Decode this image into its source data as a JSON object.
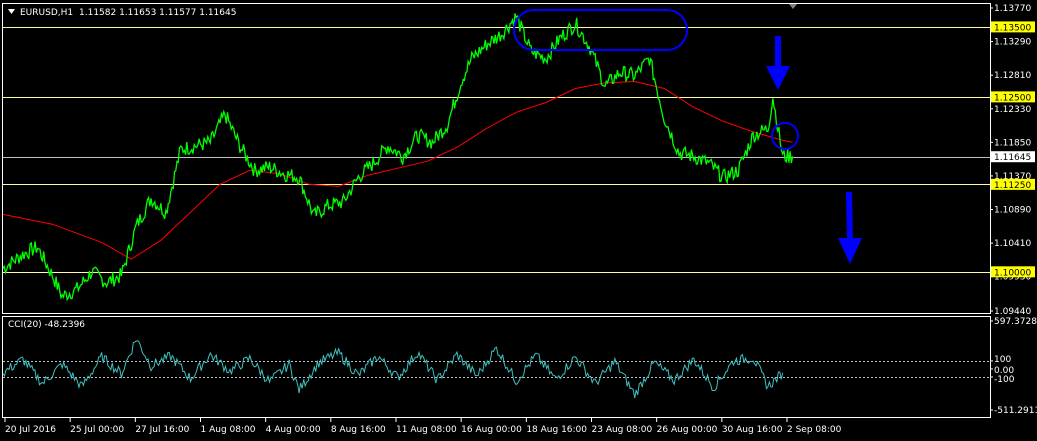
{
  "header": {
    "symbol": "EURUSD,H1",
    "ohlc": "1.11582 1.11653 1.11577 1.11645"
  },
  "indicator": {
    "label": "CCI(20) -48.2396",
    "axis_ticks": [
      "597.3728",
      "100",
      "0.00",
      "-100",
      "-511.2911"
    ]
  },
  "colors": {
    "background": "#000000",
    "price": "#00ff00",
    "moving_average": "#ff0000",
    "horizontal_level": "#ffff99",
    "current_price_line": "#c0c0c0",
    "cci": "#40c0c0",
    "annotation": "#0000ff",
    "label_highlight": "#ffff00",
    "axis": "#ffffff"
  },
  "icons": {
    "dropdown": "triangle-down-icon",
    "annotation_arrow": "down-arrow-icon",
    "annotation_ellipse": "ellipse-icon",
    "annotation_circle": "circle-icon"
  },
  "chart_data": [
    {
      "type": "line",
      "ylim": [
        1.0944,
        1.1377
      ],
      "y_ticks": [
        "1.13770",
        "1.13290",
        "1.12810",
        "1.12330",
        "1.11850",
        "1.11370",
        "1.10890",
        "1.10410",
        "1.09930",
        "1.09440"
      ],
      "x_ticks": [
        "20 Jul 2016",
        "25 Jul 00:00",
        "27 Jul 16:00",
        "1 Aug 08:00",
        "4 Aug 00:00",
        "8 Aug 16:00",
        "11 Aug 08:00",
        "16 Aug 00:00",
        "18 Aug 16:00",
        "23 Aug 08:00",
        "26 Aug 00:00",
        "30 Aug 16:00",
        "2 Sep 08:00"
      ],
      "levels": [
        {
          "label": "1.13500",
          "value": 1.135
        },
        {
          "label": "1.12500",
          "value": 1.125
        },
        {
          "label": "1.11250",
          "value": 1.1125
        },
        {
          "label": "1.10000",
          "value": 1.1
        }
      ],
      "current_price": {
        "label": "1.11645",
        "value": 1.11645
      },
      "series": [
        {
          "x": [
            0,
            0.02,
            0.035,
            0.05,
            0.06,
            0.075,
            0.09,
            0.105,
            0.12,
            0.135,
            0.15,
            0.165,
            0.18,
            0.195,
            0.21,
            0.225,
            0.24,
            0.255,
            0.27,
            0.285,
            0.3,
            0.315,
            0.33,
            0.345,
            0.36,
            0.375,
            0.39,
            0.405,
            0.42,
            0.435,
            0.45,
            0.465,
            0.475,
            0.49,
            0.505,
            0.52,
            0.535,
            0.55,
            0.565,
            0.58,
            0.595,
            0.61,
            0.625,
            0.64,
            0.655,
            0.67,
            0.685,
            0.7,
            0.715,
            0.73,
            0.745,
            0.76,
            0.775,
            0.78,
            0.79,
            0.8
          ],
          "values": [
            1.1005,
            1.1025,
            1.1035,
            1.0995,
            1.0965,
            1.0975,
            1.1,
            1.0985,
            1.0995,
            1.1065,
            1.1105,
            1.1085,
            1.1175,
            1.118,
            1.1185,
            1.1225,
            1.118,
            1.1145,
            1.115,
            1.114,
            1.1135,
            1.108,
            1.1095,
            1.11,
            1.1135,
            1.1155,
            1.118,
            1.1165,
            1.1195,
            1.1185,
            1.121,
            1.1275,
            1.1305,
            1.1325,
            1.134,
            1.1365,
            1.1315,
            1.1305,
            1.1335,
            1.1355,
            1.132,
            1.1265,
            1.1285,
            1.128,
            1.1305,
            1.122,
            1.117,
            1.1165,
            1.1155,
            1.1135,
            1.1145,
            1.1195,
            1.1205,
            1.125,
            1.1165,
            1.1165
          ]
        },
        {
          "x": [
            0,
            0.05,
            0.1,
            0.13,
            0.16,
            0.19,
            0.22,
            0.25,
            0.28,
            0.31,
            0.34,
            0.37,
            0.4,
            0.43,
            0.46,
            0.49,
            0.52,
            0.55,
            0.58,
            0.61,
            0.64,
            0.67,
            0.7,
            0.73,
            0.76,
            0.79,
            0.8
          ],
          "values": [
            1.1082,
            1.1068,
            1.1042,
            1.1018,
            1.1045,
            1.1085,
            1.1125,
            1.1145,
            1.114,
            1.1125,
            1.1122,
            1.1138,
            1.1148,
            1.1158,
            1.1178,
            1.1205,
            1.1228,
            1.1242,
            1.1262,
            1.127,
            1.1272,
            1.1262,
            1.1235,
            1.1215,
            1.12,
            1.1188,
            1.1185
          ]
        }
      ]
    },
    {
      "type": "line",
      "title": "CCI(20) -48.2396",
      "ylim": [
        -511.2911,
        597.3728
      ],
      "y_ticks": [
        "597.3728",
        "100",
        "0.00",
        "-100",
        "-511.2911"
      ],
      "levels": [
        100,
        -100
      ],
      "series": [
        {
          "x": [
            0,
            0.02,
            0.04,
            0.06,
            0.08,
            0.1,
            0.12,
            0.135,
            0.15,
            0.17,
            0.19,
            0.21,
            0.23,
            0.25,
            0.27,
            0.29,
            0.3,
            0.32,
            0.34,
            0.36,
            0.38,
            0.4,
            0.42,
            0.44,
            0.46,
            0.48,
            0.5,
            0.52,
            0.54,
            0.56,
            0.58,
            0.6,
            0.62,
            0.64,
            0.66,
            0.68,
            0.7,
            0.72,
            0.74,
            0.76,
            0.775,
            0.79
          ],
          "values": [
            -50,
            120,
            -180,
            60,
            -220,
            150,
            -60,
            380,
            40,
            160,
            -120,
            180,
            -30,
            130,
            -160,
            60,
            -260,
            80,
            200,
            -80,
            160,
            -110,
            210,
            -140,
            180,
            -90,
            260,
            -150,
            170,
            -130,
            150,
            -180,
            90,
            -320,
            80,
            -140,
            120,
            -230,
            100,
            140,
            -220,
            -48
          ]
        }
      ]
    }
  ]
}
